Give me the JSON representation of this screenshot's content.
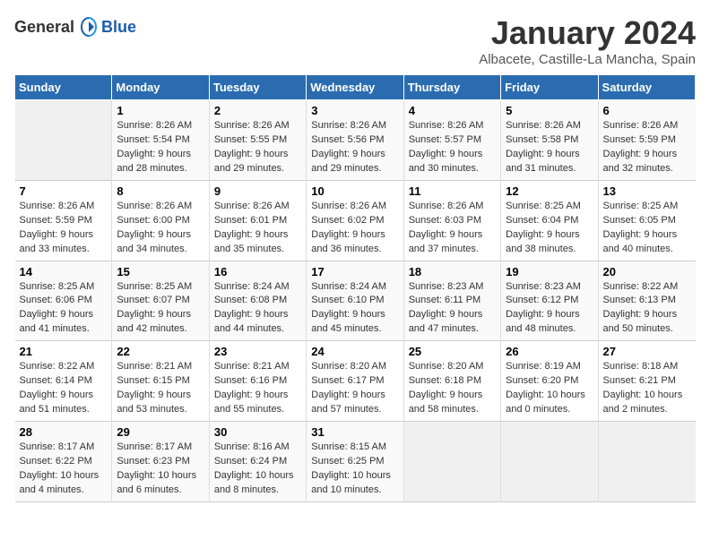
{
  "header": {
    "logo_general": "General",
    "logo_blue": "Blue",
    "title": "January 2024",
    "subtitle": "Albacete, Castille-La Mancha, Spain"
  },
  "weekdays": [
    "Sunday",
    "Monday",
    "Tuesday",
    "Wednesday",
    "Thursday",
    "Friday",
    "Saturday"
  ],
  "weeks": [
    [
      {
        "day": "",
        "empty": true
      },
      {
        "day": "1",
        "sunrise": "Sunrise: 8:26 AM",
        "sunset": "Sunset: 5:54 PM",
        "daylight": "Daylight: 9 hours and 28 minutes."
      },
      {
        "day": "2",
        "sunrise": "Sunrise: 8:26 AM",
        "sunset": "Sunset: 5:55 PM",
        "daylight": "Daylight: 9 hours and 29 minutes."
      },
      {
        "day": "3",
        "sunrise": "Sunrise: 8:26 AM",
        "sunset": "Sunset: 5:56 PM",
        "daylight": "Daylight: 9 hours and 29 minutes."
      },
      {
        "day": "4",
        "sunrise": "Sunrise: 8:26 AM",
        "sunset": "Sunset: 5:57 PM",
        "daylight": "Daylight: 9 hours and 30 minutes."
      },
      {
        "day": "5",
        "sunrise": "Sunrise: 8:26 AM",
        "sunset": "Sunset: 5:58 PM",
        "daylight": "Daylight: 9 hours and 31 minutes."
      },
      {
        "day": "6",
        "sunrise": "Sunrise: 8:26 AM",
        "sunset": "Sunset: 5:59 PM",
        "daylight": "Daylight: 9 hours and 32 minutes."
      }
    ],
    [
      {
        "day": "7",
        "sunrise": "Sunrise: 8:26 AM",
        "sunset": "Sunset: 5:59 PM",
        "daylight": "Daylight: 9 hours and 33 minutes."
      },
      {
        "day": "8",
        "sunrise": "Sunrise: 8:26 AM",
        "sunset": "Sunset: 6:00 PM",
        "daylight": "Daylight: 9 hours and 34 minutes."
      },
      {
        "day": "9",
        "sunrise": "Sunrise: 8:26 AM",
        "sunset": "Sunset: 6:01 PM",
        "daylight": "Daylight: 9 hours and 35 minutes."
      },
      {
        "day": "10",
        "sunrise": "Sunrise: 8:26 AM",
        "sunset": "Sunset: 6:02 PM",
        "daylight": "Daylight: 9 hours and 36 minutes."
      },
      {
        "day": "11",
        "sunrise": "Sunrise: 8:26 AM",
        "sunset": "Sunset: 6:03 PM",
        "daylight": "Daylight: 9 hours and 37 minutes."
      },
      {
        "day": "12",
        "sunrise": "Sunrise: 8:25 AM",
        "sunset": "Sunset: 6:04 PM",
        "daylight": "Daylight: 9 hours and 38 minutes."
      },
      {
        "day": "13",
        "sunrise": "Sunrise: 8:25 AM",
        "sunset": "Sunset: 6:05 PM",
        "daylight": "Daylight: 9 hours and 40 minutes."
      }
    ],
    [
      {
        "day": "14",
        "sunrise": "Sunrise: 8:25 AM",
        "sunset": "Sunset: 6:06 PM",
        "daylight": "Daylight: 9 hours and 41 minutes."
      },
      {
        "day": "15",
        "sunrise": "Sunrise: 8:25 AM",
        "sunset": "Sunset: 6:07 PM",
        "daylight": "Daylight: 9 hours and 42 minutes."
      },
      {
        "day": "16",
        "sunrise": "Sunrise: 8:24 AM",
        "sunset": "Sunset: 6:08 PM",
        "daylight": "Daylight: 9 hours and 44 minutes."
      },
      {
        "day": "17",
        "sunrise": "Sunrise: 8:24 AM",
        "sunset": "Sunset: 6:10 PM",
        "daylight": "Daylight: 9 hours and 45 minutes."
      },
      {
        "day": "18",
        "sunrise": "Sunrise: 8:23 AM",
        "sunset": "Sunset: 6:11 PM",
        "daylight": "Daylight: 9 hours and 47 minutes."
      },
      {
        "day": "19",
        "sunrise": "Sunrise: 8:23 AM",
        "sunset": "Sunset: 6:12 PM",
        "daylight": "Daylight: 9 hours and 48 minutes."
      },
      {
        "day": "20",
        "sunrise": "Sunrise: 8:22 AM",
        "sunset": "Sunset: 6:13 PM",
        "daylight": "Daylight: 9 hours and 50 minutes."
      }
    ],
    [
      {
        "day": "21",
        "sunrise": "Sunrise: 8:22 AM",
        "sunset": "Sunset: 6:14 PM",
        "daylight": "Daylight: 9 hours and 51 minutes."
      },
      {
        "day": "22",
        "sunrise": "Sunrise: 8:21 AM",
        "sunset": "Sunset: 6:15 PM",
        "daylight": "Daylight: 9 hours and 53 minutes."
      },
      {
        "day": "23",
        "sunrise": "Sunrise: 8:21 AM",
        "sunset": "Sunset: 6:16 PM",
        "daylight": "Daylight: 9 hours and 55 minutes."
      },
      {
        "day": "24",
        "sunrise": "Sunrise: 8:20 AM",
        "sunset": "Sunset: 6:17 PM",
        "daylight": "Daylight: 9 hours and 57 minutes."
      },
      {
        "day": "25",
        "sunrise": "Sunrise: 8:20 AM",
        "sunset": "Sunset: 6:18 PM",
        "daylight": "Daylight: 9 hours and 58 minutes."
      },
      {
        "day": "26",
        "sunrise": "Sunrise: 8:19 AM",
        "sunset": "Sunset: 6:20 PM",
        "daylight": "Daylight: 10 hours and 0 minutes."
      },
      {
        "day": "27",
        "sunrise": "Sunrise: 8:18 AM",
        "sunset": "Sunset: 6:21 PM",
        "daylight": "Daylight: 10 hours and 2 minutes."
      }
    ],
    [
      {
        "day": "28",
        "sunrise": "Sunrise: 8:17 AM",
        "sunset": "Sunset: 6:22 PM",
        "daylight": "Daylight: 10 hours and 4 minutes."
      },
      {
        "day": "29",
        "sunrise": "Sunrise: 8:17 AM",
        "sunset": "Sunset: 6:23 PM",
        "daylight": "Daylight: 10 hours and 6 minutes."
      },
      {
        "day": "30",
        "sunrise": "Sunrise: 8:16 AM",
        "sunset": "Sunset: 6:24 PM",
        "daylight": "Daylight: 10 hours and 8 minutes."
      },
      {
        "day": "31",
        "sunrise": "Sunrise: 8:15 AM",
        "sunset": "Sunset: 6:25 PM",
        "daylight": "Daylight: 10 hours and 10 minutes."
      },
      {
        "day": "",
        "empty": true
      },
      {
        "day": "",
        "empty": true
      },
      {
        "day": "",
        "empty": true
      }
    ]
  ]
}
